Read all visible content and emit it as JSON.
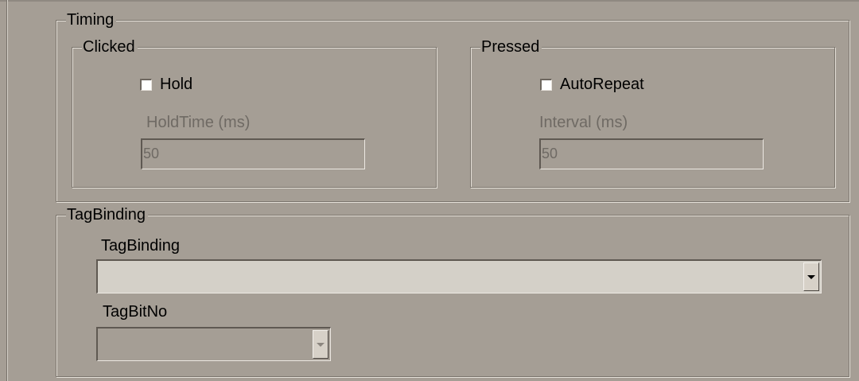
{
  "timing": {
    "title": "Timing",
    "clicked": {
      "title": "Clicked",
      "checkbox_label": "Hold",
      "checkbox_checked": false,
      "field_label": "HoldTime (ms)",
      "field_value": "50"
    },
    "pressed": {
      "title": "Pressed",
      "checkbox_label": "AutoRepeat",
      "checkbox_checked": false,
      "field_label": "Interval (ms)",
      "field_value": "50"
    }
  },
  "tag_binding": {
    "title": "TagBinding",
    "binding_label": "TagBinding",
    "binding_value": "",
    "bitno_label": "TagBitNo",
    "bitno_value": ""
  },
  "icons": {
    "binding_dropdown": "chevron-down-icon",
    "bitno_dropdown": "chevron-down-icon"
  },
  "colors": {
    "panel_background": "#a59e95",
    "binding_field_background": "#d4d0c8",
    "disabled_text": "#6f6a64"
  }
}
